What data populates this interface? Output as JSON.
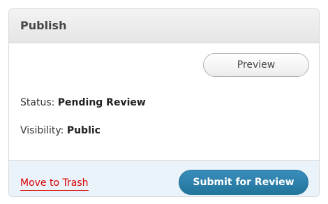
{
  "panel": {
    "title": "Publish"
  },
  "actions": {
    "preview_label": "Preview"
  },
  "status": {
    "label": "Status:",
    "value": "Pending Review"
  },
  "visibility": {
    "label": "Visibility:",
    "value": "Public"
  },
  "footer": {
    "trash_label": "Move to Trash",
    "submit_label": "Submit for Review"
  },
  "colors": {
    "trash_link": "#d90000",
    "submit_button": "#21759b",
    "footer_bg": "#eaf2fa"
  }
}
